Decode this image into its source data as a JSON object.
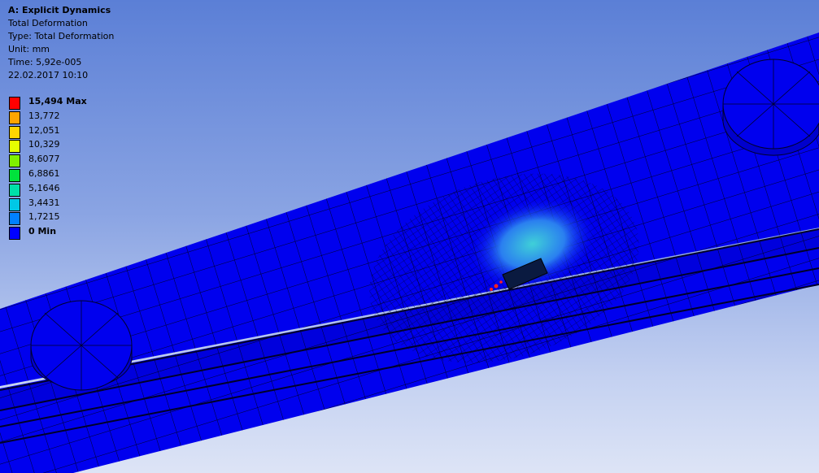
{
  "header": {
    "title": "A: Explicit Dynamics",
    "result_name": "Total Deformation",
    "type_line": "Type: Total Deformation",
    "unit_line": "Unit: mm",
    "time_line": "Time: 5,92e-005",
    "date_line": "22.02.2017 10:10"
  },
  "legend": {
    "entries": [
      {
        "label": "15,494 Max",
        "color": "#ff0000"
      },
      {
        "label": "13,772",
        "color": "#ffa500"
      },
      {
        "label": "12,051",
        "color": "#ffd500"
      },
      {
        "label": "10,329",
        "color": "#e5ff00"
      },
      {
        "label": "8,6077",
        "color": "#7ff200"
      },
      {
        "label": "6,8861",
        "color": "#00e23c"
      },
      {
        "label": "5,1646",
        "color": "#00e0a8"
      },
      {
        "label": "3,4431",
        "color": "#00c8e6"
      },
      {
        "label": "1,7215",
        "color": "#0080ff"
      },
      {
        "label": "0 Min",
        "color": "#0000ff"
      }
    ]
  },
  "colors": {
    "mesh_fill": "#0000ee",
    "mesh_line": "#00002a",
    "hot_spot": "#3fd0d8"
  }
}
